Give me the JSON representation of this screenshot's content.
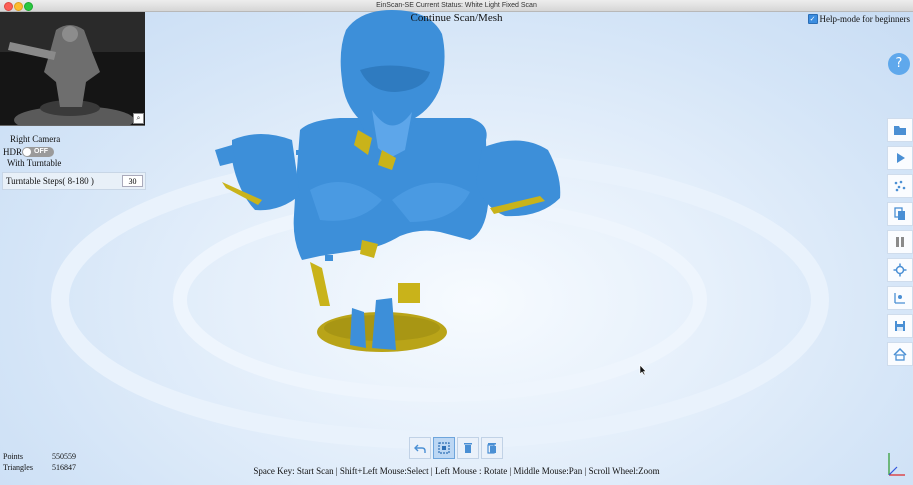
{
  "window": {
    "title": "EinScan-SE Current Status: White Light Fixed Scan"
  },
  "header": {
    "mode_title": "Continue Scan/Mesh",
    "help_mode_label": "Help-mode for beginners",
    "help_icon": "question-icon"
  },
  "left_panel": {
    "camera_label": "Right Camera",
    "hdr_label": "HDR",
    "hdr_state": "OFF",
    "turntable_label": "With Turntable",
    "steps_label": "Turntable Steps( 8-180 )",
    "steps_value": "30"
  },
  "stats": {
    "points_label": "Points",
    "points_value": "550559",
    "triangles_label": "Triangles",
    "triangles_value": "516847"
  },
  "sidebar_icons": [
    "folder-open-icon",
    "play-icon",
    "scatter-icon",
    "copy-icon",
    "pause-icon",
    "settings-icon",
    "align-icon",
    "save-icon",
    "home-icon"
  ],
  "bottom_tools": [
    "undo-icon",
    "select-fit-icon",
    "delete-icon",
    "delete-all-icon"
  ],
  "hint": "Space Key: Start Scan | Shift+Left Mouse:Select | Left Mouse : Rotate | Middle Mouse:Pan | Scroll Wheel:Zoom",
  "colors": {
    "mesh_blue": "#3d8fd9",
    "mesh_yellow": "#c9b31a",
    "accent": "#5fa8ec"
  }
}
